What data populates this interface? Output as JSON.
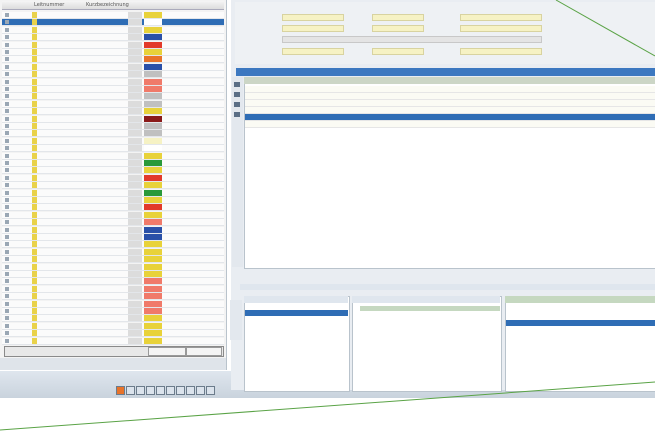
{
  "left_panel": {
    "columns": [
      "Leitnummer",
      "Kurzbezeichnung"
    ],
    "filter_value": "",
    "filter_buttons": [
      "",
      ""
    ],
    "status_text": "",
    "rows": [
      {
        "c1": "",
        "c2": "",
        "c4": "",
        "swatch": "#e8d23a"
      },
      {
        "c1": "",
        "c2": "",
        "c4": "",
        "swatch": "#ffffff",
        "selected": true
      },
      {
        "c1": "",
        "c2": "",
        "c4": "",
        "swatch": "#e8d23a"
      },
      {
        "c1": "",
        "c2": "",
        "c4": "",
        "swatch": "#2a50a8"
      },
      {
        "c1": "",
        "c2": "",
        "c4": "",
        "swatch": "#e23a2a"
      },
      {
        "c1": "",
        "c2": "",
        "c4": "",
        "swatch": "#e8d23a"
      },
      {
        "c1": "",
        "c2": "",
        "c4": "",
        "swatch": "#e8732a"
      },
      {
        "c1": "",
        "c2": "",
        "c4": "",
        "swatch": "#2a50a8"
      },
      {
        "c1": "",
        "c2": "",
        "c4": "",
        "swatch": "#c0c0c0"
      },
      {
        "c1": "",
        "c2": "",
        "c4": "",
        "swatch": "#f07a6a"
      },
      {
        "c1": "",
        "c2": "",
        "c4": "",
        "swatch": "#f07a6a"
      },
      {
        "c1": "",
        "c2": "",
        "c4": "",
        "swatch": "#c0c0c0"
      },
      {
        "c1": "",
        "c2": "",
        "c4": "",
        "swatch": "#c0c0c0"
      },
      {
        "c1": "",
        "c2": "",
        "c4": "",
        "swatch": "#e8d23a"
      },
      {
        "c1": "",
        "c2": "",
        "c4": "",
        "swatch": "#8a1a1a"
      },
      {
        "c1": "",
        "c2": "",
        "c4": "",
        "swatch": "#c0c0c0"
      },
      {
        "c1": "",
        "c2": "",
        "c4": "",
        "swatch": "#c0c0c0"
      },
      {
        "c1": "",
        "c2": "",
        "c4": "",
        "swatch": "#f6f2c4"
      },
      {
        "c1": "",
        "c2": "",
        "c4": "",
        "swatch": "#ffffff"
      },
      {
        "c1": "",
        "c2": "",
        "c4": "",
        "swatch": "#e8d23a"
      },
      {
        "c1": "",
        "c2": "",
        "c4": "",
        "swatch": "#2a9a3a"
      },
      {
        "c1": "",
        "c2": "",
        "c4": "",
        "swatch": "#e8d23a"
      },
      {
        "c1": "",
        "c2": "",
        "c4": "",
        "swatch": "#e23a2a"
      },
      {
        "c1": "",
        "c2": "",
        "c4": "",
        "swatch": "#e8d23a"
      },
      {
        "c1": "",
        "c2": "",
        "c4": "",
        "swatch": "#2a9a3a"
      },
      {
        "c1": "",
        "c2": "",
        "c4": "",
        "swatch": "#e8d23a"
      },
      {
        "c1": "",
        "c2": "",
        "c4": "",
        "swatch": "#e23a2a"
      },
      {
        "c1": "",
        "c2": "",
        "c4": "",
        "swatch": "#e8d23a"
      },
      {
        "c1": "",
        "c2": "",
        "c4": "",
        "swatch": "#f07a6a"
      },
      {
        "c1": "",
        "c2": "",
        "c4": "",
        "swatch": "#2a50a8"
      },
      {
        "c1": "",
        "c2": "",
        "c4": "",
        "swatch": "#2a50a8"
      },
      {
        "c1": "",
        "c2": "",
        "c4": "",
        "swatch": "#e8d23a"
      },
      {
        "c1": "",
        "c2": "",
        "c4": "",
        "swatch": "#e8d23a"
      },
      {
        "c1": "",
        "c2": "",
        "c4": "",
        "swatch": "#e8d23a"
      },
      {
        "c1": "",
        "c2": "",
        "c4": "",
        "swatch": "#e8d23a"
      },
      {
        "c1": "",
        "c2": "",
        "c4": "",
        "swatch": "#e8d23a"
      },
      {
        "c1": "",
        "c2": "",
        "c4": "",
        "swatch": "#f07a6a"
      },
      {
        "c1": "",
        "c2": "",
        "c4": "",
        "swatch": "#f07a6a"
      },
      {
        "c1": "",
        "c2": "",
        "c4": "",
        "swatch": "#f07a6a"
      },
      {
        "c1": "",
        "c2": "",
        "c4": "",
        "swatch": "#f07a6a"
      },
      {
        "c1": "",
        "c2": "",
        "c4": "",
        "swatch": "#f07a6a"
      },
      {
        "c1": "",
        "c2": "",
        "c4": "",
        "swatch": "#e8d23a"
      },
      {
        "c1": "",
        "c2": "",
        "c4": "",
        "swatch": "#e8d23a"
      },
      {
        "c1": "",
        "c2": "",
        "c4": "",
        "swatch": "#e8d23a"
      },
      {
        "c1": "",
        "c2": "",
        "c4": "",
        "swatch": "#e8d23a"
      }
    ]
  },
  "form": {
    "title": "",
    "fields": [
      "",
      "",
      "",
      "",
      "",
      "",
      "",
      ""
    ]
  },
  "grid": {
    "title": "",
    "headers": [
      "",
      "",
      "",
      "",
      "",
      "",
      "",
      ""
    ],
    "rows": [
      {
        "cells": [
          "",
          "",
          "",
          "",
          "",
          "",
          ""
        ]
      },
      {
        "cells": [
          "",
          "",
          "",
          "",
          "",
          "",
          ""
        ]
      },
      {
        "cells": [
          "",
          "",
          "",
          "",
          "",
          "",
          ""
        ]
      },
      {
        "cells": [
          "",
          "",
          "",
          "",
          "",
          "",
          ""
        ]
      },
      {
        "cells": [
          "",
          "",
          "",
          "",
          "",
          "",
          ""
        ],
        "selected": true
      },
      {
        "cells": [
          "",
          "",
          "",
          "",
          "",
          "",
          ""
        ]
      }
    ]
  },
  "bottom": {
    "pane1_header": "",
    "pane2_header": "",
    "pane3_header": "",
    "pane2_rows": [
      "",
      ""
    ],
    "pane3_rows": [
      "",
      "",
      "",
      ""
    ]
  },
  "taskbar": {
    "text": ""
  },
  "colors": {
    "selection": "#2f6db5",
    "grid_header_green": "#ccd6c6",
    "field_yellow": "#f6f2c4",
    "border": "#b9c3cc",
    "accent_line": "#5aa346"
  }
}
